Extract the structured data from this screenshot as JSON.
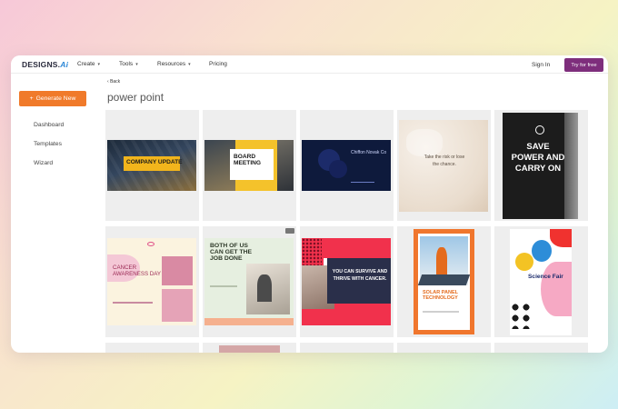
{
  "header": {
    "logo_main": "DESIGNS.",
    "logo_ai": "Ai",
    "nav": [
      {
        "label": "Create",
        "chevron": "▾"
      },
      {
        "label": "Tools",
        "chevron": "▾"
      },
      {
        "label": "Resources",
        "chevron": "▾"
      },
      {
        "label": "Pricing",
        "chevron": ""
      }
    ],
    "signin": "Sign In",
    "try_label": "Try for free"
  },
  "sidebar": {
    "generate_label": "Generate New",
    "generate_icon": "+",
    "items": [
      "Dashboard",
      "Templates",
      "Wizard"
    ]
  },
  "main": {
    "back_label": "Back",
    "title": "power point"
  },
  "templates": [
    {
      "title": "COMPANY UPDATE"
    },
    {
      "title": "BOARD MEETING"
    },
    {
      "title": "Chiffon Novak Co"
    },
    {
      "title": "Take the risk or lose the chance."
    },
    {
      "title": "SAVE POWER AND CARRY ON"
    },
    {
      "title": "CANCER AWARENESS DAY"
    },
    {
      "title": "BOTH OF US CAN GET THE JOB DONE"
    },
    {
      "title": "YOU CAN SURVIVE AND THRIVE WITH CANCER."
    },
    {
      "title": "SOLAR PANEL TECHNOLOGY"
    },
    {
      "title": "Science Fair"
    }
  ],
  "colors": {
    "accent_orange": "#f07a2a",
    "try_purple": "#7e2e7c",
    "cell_bg": "#eeeeee"
  }
}
